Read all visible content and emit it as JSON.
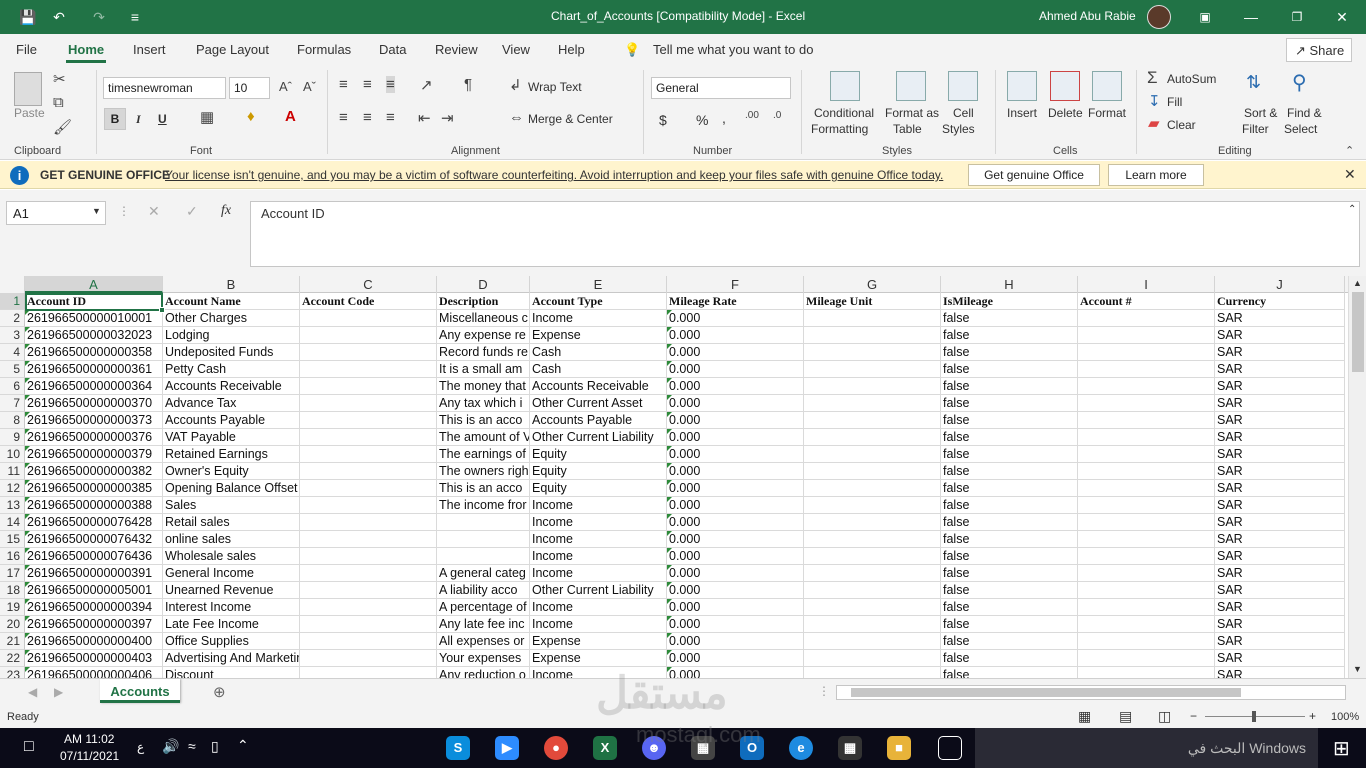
{
  "window": {
    "title": "Chart_of_Accounts  [Compatibility Mode]  -  Excel",
    "user": "Ahmed Abu Rabie"
  },
  "menu": [
    "File",
    "Home",
    "Insert",
    "Page Layout",
    "Formulas",
    "Data",
    "Review",
    "View",
    "Help"
  ],
  "tell_me": "Tell me what you want to do",
  "share": "Share",
  "ribbon": {
    "clipboard": {
      "paste": "Paste",
      "label": "Clipboard"
    },
    "font": {
      "name": "timesnewroman",
      "size": "10",
      "label": "Font",
      "bold": "B",
      "italic": "I",
      "underline": "U"
    },
    "alignment": {
      "wrap": "Wrap Text",
      "merge": "Merge & Center",
      "label": "Alignment"
    },
    "number": {
      "format": "General",
      "label": "Number",
      "currency": "$",
      "percent": "%",
      "comma": ","
    },
    "styles": {
      "conditional": "Conditional",
      "formatting": "Formatting",
      "format_as": "Format as",
      "table": "Table",
      "cell": "Cell",
      "styles": "Styles",
      "label": "Styles"
    },
    "cells": {
      "insert": "Insert",
      "delete": "Delete",
      "format": "Format",
      "label": "Cells"
    },
    "editing": {
      "autosum": "AutoSum",
      "fill": "Fill",
      "clear": "Clear",
      "sort1": "Sort &",
      "sort2": "Filter",
      "find1": "Find &",
      "find2": "Select",
      "label": "Editing"
    }
  },
  "notice": {
    "title": "GET GENUINE OFFICE",
    "message": "Your license isn't genuine, and you may be a victim of software counterfeiting. Avoid interruption and keep your files safe with genuine Office today.",
    "btn1": "Get genuine Office",
    "btn2": "Learn more"
  },
  "namebox": "A1",
  "formula": "Account ID",
  "columns": [
    "A",
    "B",
    "C",
    "D",
    "E",
    "F",
    "G",
    "H",
    "I",
    "J"
  ],
  "headers": [
    "Account ID",
    "Account Name",
    "Account Code",
    "Description",
    "Account Type",
    "Mileage Rate",
    "Mileage Unit",
    "IsMileage",
    "Account #",
    "Currency"
  ],
  "rows": [
    [
      "261966500000010001",
      "Other Charges",
      "",
      "Miscellaneous c",
      "Income",
      "0.000",
      "",
      "false",
      "",
      "SAR"
    ],
    [
      "261966500000032023",
      "Lodging",
      "",
      "Any expense re",
      "Expense",
      "0.000",
      "",
      "false",
      "",
      "SAR"
    ],
    [
      "261966500000000358",
      "Undeposited Funds",
      "",
      "Record funds re",
      "Cash",
      "0.000",
      "",
      "false",
      "",
      "SAR"
    ],
    [
      "261966500000000361",
      "Petty Cash",
      "",
      "It is a small am",
      "Cash",
      "0.000",
      "",
      "false",
      "",
      "SAR"
    ],
    [
      "261966500000000364",
      "Accounts Receivable",
      "",
      "The money that",
      "Accounts Receivable",
      "0.000",
      "",
      "false",
      "",
      "SAR"
    ],
    [
      "261966500000000370",
      "Advance Tax",
      "",
      "Any tax which i",
      "Other Current Asset",
      "0.000",
      "",
      "false",
      "",
      "SAR"
    ],
    [
      "261966500000000373",
      "Accounts Payable",
      "",
      "This is an acco",
      "Accounts Payable",
      "0.000",
      "",
      "false",
      "",
      "SAR"
    ],
    [
      "261966500000000376",
      "VAT Payable",
      "",
      "The amount of V",
      "Other Current Liability",
      "0.000",
      "",
      "false",
      "",
      "SAR"
    ],
    [
      "261966500000000379",
      "Retained Earnings",
      "",
      "The earnings of",
      "Equity",
      "0.000",
      "",
      "false",
      "",
      "SAR"
    ],
    [
      "261966500000000382",
      "Owner's Equity",
      "",
      "The owners righ",
      "Equity",
      "0.000",
      "",
      "false",
      "",
      "SAR"
    ],
    [
      "261966500000000385",
      "Opening Balance Offset",
      "",
      "This is an acco",
      "Equity",
      "0.000",
      "",
      "false",
      "",
      "SAR"
    ],
    [
      "261966500000000388",
      "Sales",
      "",
      "The income fror",
      "Income",
      "0.000",
      "",
      "false",
      "",
      "SAR"
    ],
    [
      "261966500000076428",
      "Retail sales",
      "",
      "",
      "Income",
      "0.000",
      "",
      "false",
      "",
      "SAR"
    ],
    [
      "261966500000076432",
      "online sales",
      "",
      "",
      "Income",
      "0.000",
      "",
      "false",
      "",
      "SAR"
    ],
    [
      "261966500000076436",
      "Wholesale sales",
      "",
      "",
      "Income",
      "0.000",
      "",
      "false",
      "",
      "SAR"
    ],
    [
      "261966500000000391",
      "General Income",
      "",
      "A general categ",
      "Income",
      "0.000",
      "",
      "false",
      "",
      "SAR"
    ],
    [
      "261966500000005001",
      "Unearned Revenue",
      "",
      "A liability acco",
      "Other Current Liability",
      "0.000",
      "",
      "false",
      "",
      "SAR"
    ],
    [
      "261966500000000394",
      "Interest Income",
      "",
      "A percentage of",
      "Income",
      "0.000",
      "",
      "false",
      "",
      "SAR"
    ],
    [
      "261966500000000397",
      "Late Fee Income",
      "",
      "Any late fee inc",
      "Income",
      "0.000",
      "",
      "false",
      "",
      "SAR"
    ],
    [
      "261966500000000400",
      "Office Supplies",
      "",
      "All expenses or",
      "Expense",
      "0.000",
      "",
      "false",
      "",
      "SAR"
    ],
    [
      "261966500000000403",
      "Advertising And Marketing",
      "",
      "Your expenses",
      "Expense",
      "0.000",
      "",
      "false",
      "",
      "SAR"
    ],
    [
      "261966500000000406",
      "Discount",
      "",
      "Any reduction o",
      "Income",
      "0.000",
      "",
      "false",
      "",
      "SAR"
    ]
  ],
  "sheet_tab": "Accounts",
  "status": {
    "ready": "Ready",
    "zoom": "100%"
  },
  "taskbar": {
    "time": "AM 11:02",
    "date": "07/11/2021",
    "search": "البحث في Windows",
    "lang": "ع"
  },
  "watermark": {
    "text": "مستقل",
    "sub": "mostaql.com"
  }
}
